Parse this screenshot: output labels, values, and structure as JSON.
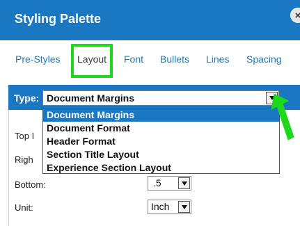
{
  "window": {
    "title": "Styling Palette",
    "close_icon": "×"
  },
  "tabs": [
    {
      "label": "Pre-Styles"
    },
    {
      "label": "Layout"
    },
    {
      "label": "Font"
    },
    {
      "label": "Bullets"
    },
    {
      "label": "Lines"
    },
    {
      "label": "Spacing"
    }
  ],
  "active_tab": "Layout",
  "type": {
    "label": "Type:",
    "selected": "Document Margins",
    "options": [
      "Document Margins",
      "Document Format",
      "Header Format",
      "Section Title Layout",
      "Experience Section Layout"
    ]
  },
  "fields": {
    "top_label": "Top I",
    "right_label": "Righ",
    "bottom_label": "Bottom:",
    "bottom_value": ".5",
    "unit_label": "Unit:",
    "unit_value": "Inch"
  },
  "colors": {
    "accent": "#1a78c2",
    "highlight_box": "#1ed81e",
    "annotation_arrow": "#1ed81e"
  }
}
